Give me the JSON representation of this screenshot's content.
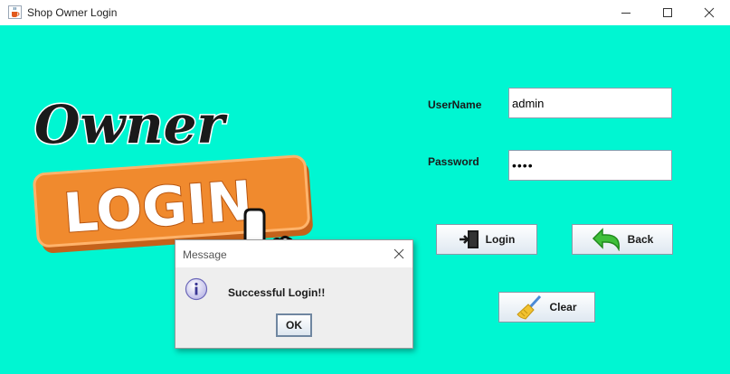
{
  "window": {
    "title": "Shop Owner Login",
    "icons": {
      "app": "java-cup-icon",
      "minimize": "minimize-icon",
      "maximize": "maximize-icon",
      "close": "close-icon"
    }
  },
  "logo": {
    "line1": "Owner",
    "line2": "LOGIN",
    "pointer": "hand-pointer-icon"
  },
  "form": {
    "username_label": "UserName",
    "username_value": "admin",
    "password_label": "Password",
    "password_value": "••••"
  },
  "buttons": {
    "login": {
      "label": "Login",
      "icon": "door-enter-icon"
    },
    "back": {
      "label": "Back",
      "icon": "back-arrow-icon"
    },
    "clear": {
      "label": "Clear",
      "icon": "broom-icon"
    }
  },
  "dialog": {
    "title": "Message",
    "message": "Successful Login!!",
    "ok_label": "OK",
    "icon": "info-icon"
  },
  "colors": {
    "background": "#00f6d2",
    "logo_orange": "#f08a2e"
  }
}
